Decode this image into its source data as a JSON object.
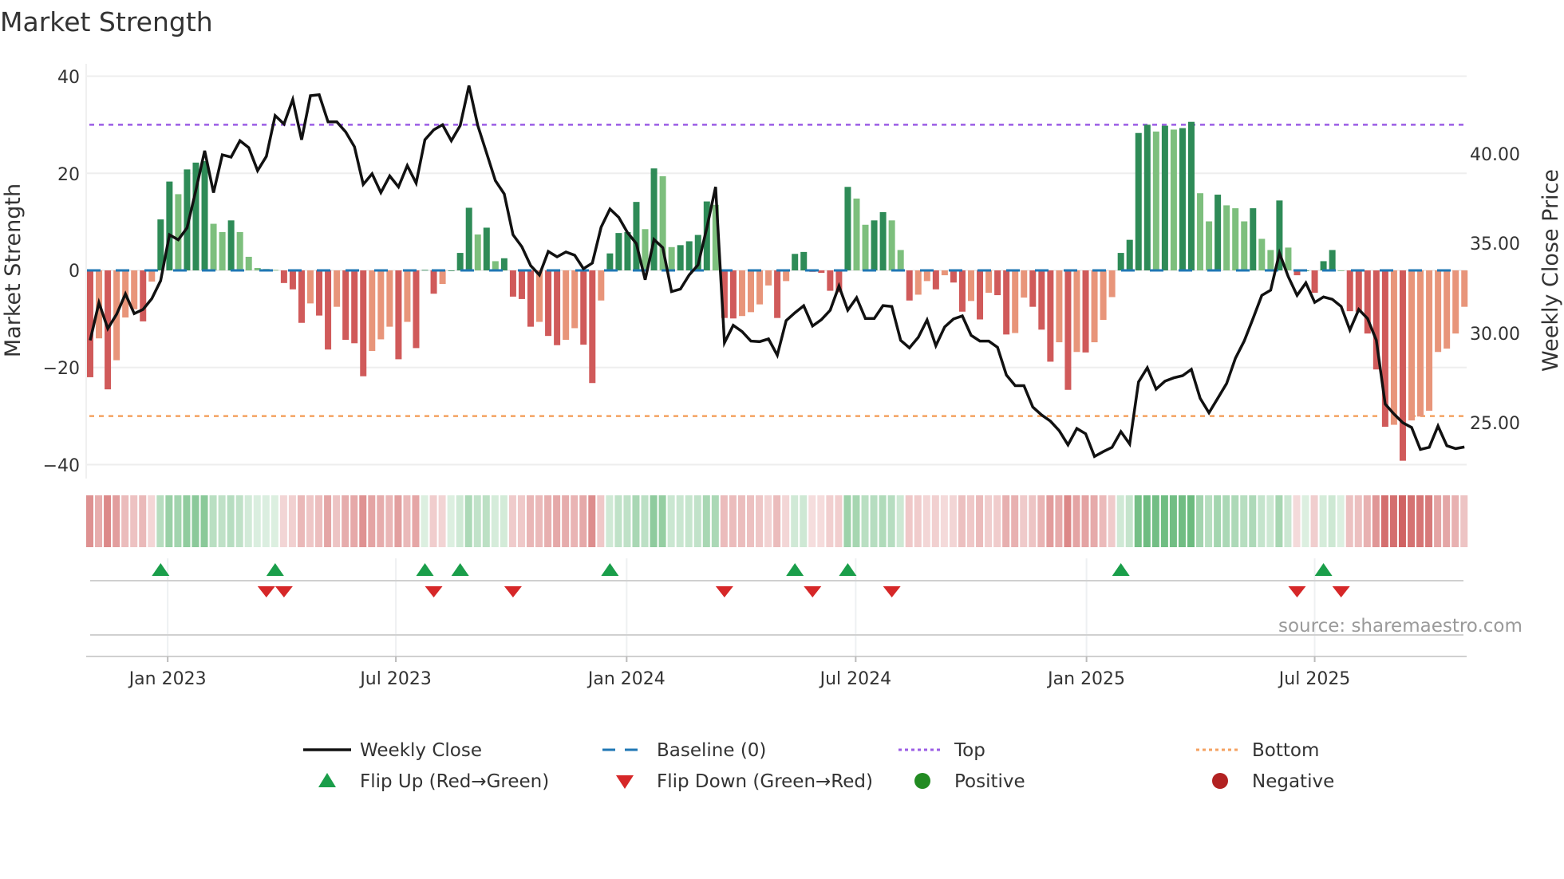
{
  "chart_data": {
    "type": "bar",
    "title": "Market Strength",
    "ylabel": "Market Strength",
    "ylabel_right": "Weekly Close Price",
    "ylim": [
      -42.5,
      42.5
    ],
    "ylim_right": [
      22.1,
      45.0
    ],
    "yticks": [
      "40",
      "20",
      "0",
      "−20",
      "−40"
    ],
    "yticks_values": [
      40,
      20,
      0,
      -20,
      -40
    ],
    "yticks_right": [
      "40.00",
      "35.00",
      "30.00",
      "25.00"
    ],
    "yticks_right_values": [
      40,
      35,
      30,
      25
    ],
    "x_unit": "week index (weekly bars, Nov 2022 – Oct 2025)",
    "xticks": [
      "Jan 2023",
      "Jul 2023",
      "Jan 2024",
      "Jul 2024",
      "Jan 2025",
      "Jul 2025"
    ],
    "xticks_week": [
      8.8,
      34.7,
      60.9,
      86.9,
      113.1,
      139.0
    ],
    "top_level": 30,
    "bottom_level": -30,
    "baseline": 0,
    "strength": [
      -22,
      -14,
      -24.5,
      -18.5,
      -9.7,
      -8,
      -10.5,
      -2.3,
      10.5,
      18.3,
      15.7,
      20.8,
      22.2,
      22.5,
      9.6,
      7.9,
      10.3,
      7.9,
      2.8,
      0.5,
      0.3,
      0.1,
      -2.6,
      -3.9,
      -10.8,
      -6.8,
      -9.3,
      -16.3,
      -7.5,
      -14.3,
      -15,
      -21.8,
      -16.6,
      -14.2,
      -11.6,
      -18.3,
      -10.6,
      -16,
      0.1,
      -4.8,
      -2.8,
      0,
      3.6,
      12.9,
      7.4,
      8.8,
      1.9,
      2.5,
      -5.4,
      -5.9,
      -11.6,
      -10.6,
      -13.5,
      -15.4,
      -14.3,
      -11.9,
      -15.3,
      -23.2,
      -6.2,
      3.5,
      7.7,
      7.9,
      14.1,
      8.5,
      21,
      19.4,
      4.8,
      5.2,
      6.0,
      7.3,
      14.2,
      13.5,
      -9.8,
      -9.9,
      -9.4,
      -8.6,
      -7,
      -3.1,
      -9.8,
      -2.2,
      3.4,
      3.8,
      -0.3,
      -0.5,
      -4.2,
      -4.5,
      17.2,
      14.8,
      9.4,
      10.3,
      12,
      10.3,
      4.2,
      -6.2,
      -5,
      -2.2,
      -3.9,
      -1,
      -2.5,
      -8.5,
      -6.3,
      -10.1,
      -4.6,
      -5.1,
      -13.2,
      -12.9,
      -5.6,
      -7.5,
      -12.2,
      -18.8,
      -14.8,
      -24.6,
      -16.8,
      -16.9,
      -14.8,
      -10.2,
      -5.5,
      3.6,
      6.3,
      28.3,
      30,
      28.6,
      29.8,
      29,
      29.3,
      30.6,
      15.9,
      10.1,
      15.6,
      13.4,
      12.8,
      10.1,
      12.8,
      6.5,
      4.2,
      14.4,
      4.7,
      -1,
      0,
      -4.6,
      1.9,
      4.2,
      0,
      -8.4,
      -8.5,
      -13,
      -20.4,
      -32.2,
      -31.8,
      -39.2,
      -30.9,
      -30.1,
      -28.9,
      -16.8,
      -16.1,
      -13,
      -7.5
    ],
    "weekly_close": [
      29.6,
      31.7,
      30.26,
      31.05,
      32.19,
      31.09,
      31.32,
      31.93,
      32.93,
      35.49,
      35.21,
      35.88,
      37.98,
      40.18,
      37.84,
      39.95,
      39.82,
      40.74,
      40.35,
      39.07,
      39.86,
      42.14,
      41.67,
      43.04,
      40.79,
      43.25,
      43.3,
      41.79,
      41.79,
      41.23,
      40.4,
      38.3,
      38.89,
      37.84,
      38.77,
      38.16,
      39.35,
      38.37,
      40.79,
      41.35,
      41.63,
      40.74,
      41.58,
      43.81,
      41.58,
      40.05,
      38.51,
      37.77,
      35.49,
      34.82,
      33.77,
      33.25,
      34.56,
      34.26,
      34.53,
      34.35,
      33.6,
      33.91,
      35.91,
      36.93,
      36.46,
      35.61,
      35.0,
      32.98,
      35.23,
      34.77,
      32.32,
      32.46,
      33.25,
      33.81,
      35.88,
      38.16,
      29.47,
      30.44,
      30.09,
      29.56,
      29.53,
      29.68,
      28.77,
      30.7,
      31.14,
      31.53,
      30.4,
      30.75,
      31.28,
      32.63,
      31.28,
      31.98,
      30.82,
      30.82,
      31.54,
      31.49,
      29.6,
      29.18,
      29.77,
      30.74,
      29.3,
      30.35,
      30.79,
      30.96,
      29.88,
      29.56,
      29.56,
      29.21,
      27.67,
      27.07,
      27.07,
      25.88,
      25.44,
      25.09,
      24.56,
      23.77,
      24.68,
      24.39,
      23.12,
      23.39,
      23.63,
      24.51,
      23.82,
      27.28,
      28.07,
      26.88,
      27.32,
      27.51,
      27.63,
      27.98,
      26.37,
      25.56,
      26.37,
      27.19,
      28.6,
      29.56,
      30.82,
      32.11,
      32.4,
      34.47,
      33.16,
      32.11,
      32.81,
      31.72,
      32.02,
      31.89,
      31.49,
      30.18,
      31.32,
      30.82,
      29.61,
      26.05,
      25.49,
      25.0,
      24.74,
      23.51,
      23.63,
      24.82,
      23.72,
      23.56,
      23.65
    ],
    "flip_up_weeks": [
      8,
      21,
      38,
      42,
      59,
      80,
      86,
      117,
      140
    ],
    "flip_down_weeks": [
      20,
      22,
      39,
      48,
      72,
      82,
      91,
      137,
      142
    ],
    "legend": {
      "placement": "bottom",
      "weekly_close": "Weekly Close",
      "baseline": "Baseline (0)",
      "top": "Top",
      "bottom": "Bottom",
      "flip_up": "Flip Up (Red→Green)",
      "flip_down": "Flip Down (Green→Red)",
      "positive": "Positive",
      "negative": "Negative"
    },
    "colors": {
      "rising_positive": "#2e8b57",
      "falling_positive": "#7dbf7d",
      "falling_negative": "#d05a5a",
      "rising_negative": "#e8957a",
      "line": "#111111",
      "baseline": "#1f77b4",
      "top": "#9b5de5",
      "bottom": "#f4a261",
      "flip_up": "#1a9e4a",
      "flip_down": "#d62728",
      "positive": "#228b22",
      "negative": "#b22222"
    }
  },
  "source": "source: sharemaestro.com"
}
